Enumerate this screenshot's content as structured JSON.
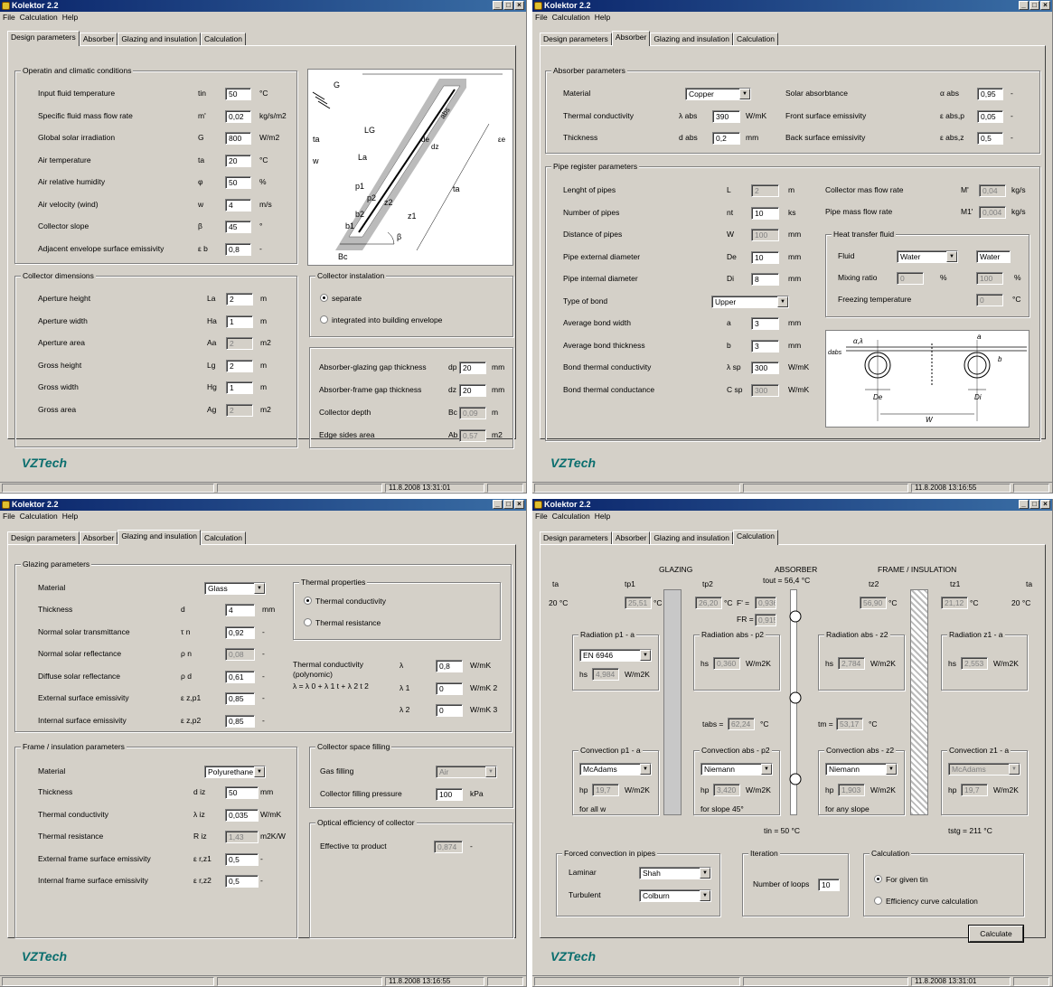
{
  "app": {
    "title": "Kolektor 2.2",
    "menus": [
      "File",
      "Calculation",
      "Help"
    ],
    "tabs": [
      "Design parameters",
      "Absorber",
      "Glazing and insulation",
      "Calculation"
    ],
    "logo": "VZTech"
  },
  "w1": {
    "status": "11.8.2008 13:31:01",
    "op": {
      "title": "Operatin and climatic conditions",
      "rows": [
        {
          "label": "Input fluid temperature",
          "sym": "tin",
          "val": "50",
          "unit": "°C"
        },
        {
          "label": "Specific fluid mass flow rate",
          "sym": "m'",
          "val": "0,02",
          "unit": "kg/s/m2"
        },
        {
          "label": "Global solar irradiation",
          "sym": "G",
          "val": "800",
          "unit": "W/m2"
        },
        {
          "label": "Air temperature",
          "sym": "ta",
          "val": "20",
          "unit": "°C"
        },
        {
          "label": "Air relative humidity",
          "sym": "φ",
          "val": "50",
          "unit": "%"
        },
        {
          "label": "Air velocity (wind)",
          "sym": "w",
          "val": "4",
          "unit": "m/s"
        },
        {
          "label": "Collector slope",
          "sym": "β",
          "val": "45",
          "unit": "°"
        },
        {
          "label": "Adjacent envelope surface emissivity",
          "sym": "ε b",
          "val": "0,8",
          "unit": "-"
        }
      ]
    },
    "dims": {
      "title": "Collector dimensions",
      "rows": [
        {
          "label": "Aperture height",
          "sym": "La",
          "val": "2",
          "unit": "m"
        },
        {
          "label": "Aperture width",
          "sym": "Ha",
          "val": "1",
          "unit": "m"
        },
        {
          "label": "Aperture area",
          "sym": "Aa",
          "val": "2",
          "unit": "m2"
        },
        {
          "label": "Gross height",
          "sym": "Lg",
          "val": "2",
          "unit": "m"
        },
        {
          "label": "Gross width",
          "sym": "Hg",
          "val": "1",
          "unit": "m"
        },
        {
          "label": "Gross area",
          "sym": "Ag",
          "val": "2",
          "unit": "m2"
        }
      ]
    },
    "inst": {
      "title": "Collector instalation",
      "opt1": "separate",
      "opt2": "integrated into building envelope"
    },
    "gaps": {
      "rows": [
        {
          "label": "Absorber-glazing gap thickness",
          "sym": "dp",
          "val": "20",
          "unit": "mm"
        },
        {
          "label": "Absorber-frame gap thickness",
          "sym": "dz",
          "val": "20",
          "unit": "mm"
        },
        {
          "label": "Collector depth",
          "sym": "Bc",
          "val": "0,09",
          "unit": "m"
        },
        {
          "label": "Edge sides area",
          "sym": "Ab",
          "val": "0,57",
          "unit": "m2"
        }
      ]
    },
    "diag": {
      "G": "G",
      "Lg": "LG",
      "La": "La",
      "w": "w",
      "ta": "ta",
      "t1": "ta",
      "p1": "p1",
      "p2": "p2",
      "z1": "z1",
      "z2": "z2",
      "b1": "b1",
      "b2": "b2",
      "Bc": "Bc",
      "beta": "β",
      "de": "de",
      "dz": "dz",
      "abs": "abs",
      "ec": "εe"
    }
  },
  "w2": {
    "status": "11.8.2008 13:16:55",
    "ap": {
      "title": "Absorber parameters",
      "mat_label": "Material",
      "mat": "Copper",
      "tc_label": "Thermal conductivity",
      "tc_sym": "λ abs",
      "tc": "390",
      "tc_unit": "W/mK",
      "th_label": "Thickness",
      "th_sym": "d abs",
      "th": "0,2",
      "th_unit": "mm",
      "sa_label": "Solar absorbtance",
      "sa_sym": "α abs",
      "sa": "0,95",
      "fe_label": "Front surface emissivity",
      "fe_sym": "ε abs,p",
      "fe": "0,05",
      "be_label": "Back surface emissivity",
      "be_sym": "ε abs,z",
      "be": "0,5",
      "dash": "-"
    },
    "pr": {
      "title": "Pipe register parameters",
      "rows": [
        {
          "label": "Lenght of pipes",
          "sym": "L",
          "val": "2",
          "unit": "m"
        },
        {
          "label": "Number of pipes",
          "sym": "nt",
          "val": "10",
          "unit": "ks"
        },
        {
          "label": "Distance of pipes",
          "sym": "W",
          "val": "100",
          "unit": "mm"
        },
        {
          "label": "Pipe external diameter",
          "sym": "De",
          "val": "10",
          "unit": "mm"
        },
        {
          "label": "Pipe internal diameter",
          "sym": "Di",
          "val": "8",
          "unit": "mm"
        },
        {
          "label": "Type of bond",
          "sym": "",
          "val": "",
          "unit": ""
        },
        {
          "label": "Average bond width",
          "sym": "a",
          "val": "3",
          "unit": "mm"
        },
        {
          "label": "Average bond thickness",
          "sym": "b",
          "val": "3",
          "unit": "mm"
        },
        {
          "label": "Bond thermal conductivity",
          "sym": "λ sp",
          "val": "300",
          "unit": "W/mK"
        },
        {
          "label": "Bond thermal conductance",
          "sym": "C sp",
          "val": "300",
          "unit": "W/mK"
        }
      ],
      "bond": "Upper",
      "cmf_label": "Collector mas flow rate",
      "cmf_sym": "M'",
      "cmf": "0,04",
      "cmf_unit": "kg/s",
      "pmf_label": "Pipe mass flow rate",
      "pmf_sym": "M1'",
      "pmf": "0,004",
      "pmf_unit": "kg/s"
    },
    "htf": {
      "title": "Heat transfer fluid",
      "fluid_label": "Fluid",
      "fluid": "Water",
      "fluid2": "Water",
      "mix_label": "Mixing ratio",
      "mix": "0",
      "mix_u": "%",
      "mix2": "100",
      "mix2_u": "%",
      "fr_label": "Freezing temperature",
      "fr": "0",
      "fr_u": "°C"
    },
    "diag": {
      "dabs": "dabs",
      "al": "α,λ",
      "a": "a",
      "b": "b",
      "De": "De",
      "Di": "Di",
      "W": "W"
    }
  },
  "w3": {
    "status": "11.8.2008 13:16:55",
    "gp": {
      "title": "Glazing parameters",
      "mat_label": "Material",
      "mat": "Glass",
      "rows": [
        {
          "label": "Thickness",
          "sym": "d",
          "val": "4",
          "unit": "mm"
        },
        {
          "label": "Normal solar transmittance",
          "sym": "τ n",
          "val": "0,92",
          "unit": "-"
        },
        {
          "label": "Normal solar reflectance",
          "sym": "ρ n",
          "val": "0,08",
          "unit": "-"
        },
        {
          "label": "Diffuse solar reflectance",
          "sym": "ρ d",
          "val": "0,61",
          "unit": "-"
        },
        {
          "label": "External surface emissivity",
          "sym": "ε z,p1",
          "val": "0,85",
          "unit": "-"
        },
        {
          "label": "Internal surface emissivity",
          "sym": "ε z,p2",
          "val": "0,85",
          "unit": "-"
        }
      ]
    },
    "tp": {
      "title": "Thermal properties",
      "opt1": "Thermal conductivity",
      "opt2": "Thermal resistance"
    },
    "poly": {
      "label": "Thermal conductivity (polynomic)",
      "formula": "λ = λ 0 + λ 1 t + λ 2 t 2",
      "rows": [
        {
          "sym": "λ",
          "val": "0,8",
          "unit": "W/mK"
        },
        {
          "sym": "λ 1",
          "val": "0",
          "unit": "W/mK 2"
        },
        {
          "sym": "λ 2",
          "val": "0",
          "unit": "W/mK 3"
        }
      ]
    },
    "fi": {
      "title": "Frame / insulation parameters",
      "mat_label": "Material",
      "mat": "Polyurethane",
      "rows": [
        {
          "label": "Thickness",
          "sym": "d iz",
          "val": "50",
          "unit": "mm"
        },
        {
          "label": "Thermal conductivity",
          "sym": "λ iz",
          "val": "0,035",
          "unit": "W/mK"
        },
        {
          "label": "Thermal resistance",
          "sym": "R iz",
          "val": "1,43",
          "unit": "m2K/W"
        },
        {
          "label": "External frame surface emissivity",
          "sym": "ε r,z1",
          "val": "0,5",
          "unit": "-"
        },
        {
          "label": "Internal frame surface emissivity",
          "sym": "ε r,z2",
          "val": "0,5",
          "unit": "-"
        }
      ]
    },
    "csf": {
      "title": "Collector space filling",
      "gas_label": "Gas filling",
      "gas": "Air",
      "pr_label": "Collector filling pressure",
      "pr": "100",
      "pr_unit": "kPa"
    },
    "oe": {
      "title": "Optical efficiency of collector",
      "label": "Effective τα product",
      "val": "0,874",
      "unit": "-"
    }
  },
  "w4": {
    "status": "11.8.2008 13:31:01",
    "hdr": {
      "glazing": "GLAZING",
      "absorber": "ABSORBER",
      "frame": "FRAME / INSULATION",
      "ta": "ta",
      "tp1": "tp1",
      "tp2": "tp2",
      "tout": "tout = 56,4 °C",
      "tz2": "tz2",
      "tz1": "tz1",
      "ta2": "ta"
    },
    "vals": {
      "ta": "20 °C",
      "tp1": "25,51",
      "tp2": "26,20",
      "F": "F' =",
      "Fv": "0,936",
      "FR": "FR =",
      "FRv": "0,915",
      "tz2": "56,90",
      "tz1": "21,12",
      "ta2": "20 °C",
      "degC": "°C"
    },
    "rad": [
      {
        "title": "Radiation p1 - a",
        "sel": "EN 6946",
        "hs": "4,984"
      },
      {
        "title": "Radiation abs - p2",
        "hs": "0,360"
      },
      {
        "title": "Radiation abs - z2",
        "hs": "2,784"
      },
      {
        "title": "Radiation z1 - a",
        "hs": "2,553"
      }
    ],
    "hs_label": "hs",
    "hu": "W/m2K",
    "tabs": "tabs =",
    "tabsv": "62,24",
    "tm": "tm =",
    "tmv": "53,17",
    "conv": [
      {
        "title": "Convection p1 - a",
        "sel": "McAdams",
        "hp": "19,7",
        "note": "for all w"
      },
      {
        "title": "Convection abs - p2",
        "sel": "Niemann",
        "hp": "3,420",
        "note": "for slope 45°"
      },
      {
        "title": "Convection abs - z2",
        "sel": "Niemann",
        "hp": "1,903",
        "note": "for any slope"
      },
      {
        "title": "Convection z1 - a",
        "sel": "McAdams",
        "hp": "19,7",
        "note": ""
      }
    ],
    "hp_label": "hp",
    "tin": "tin = 50 °C",
    "tstg": "tstg = 211 °C",
    "fc": {
      "title": "Forced convection in pipes",
      "lam_label": "Laminar",
      "lam": "Shah",
      "tur_label": "Turbulent",
      "tur": "Colburn"
    },
    "it": {
      "title": "Iteration",
      "label": "Number of loops",
      "val": "10"
    },
    "calc": {
      "title": "Calculation",
      "opt1": "For given tin",
      "opt2": "Efficiency curve calculation",
      "btn": "Calculate"
    }
  }
}
